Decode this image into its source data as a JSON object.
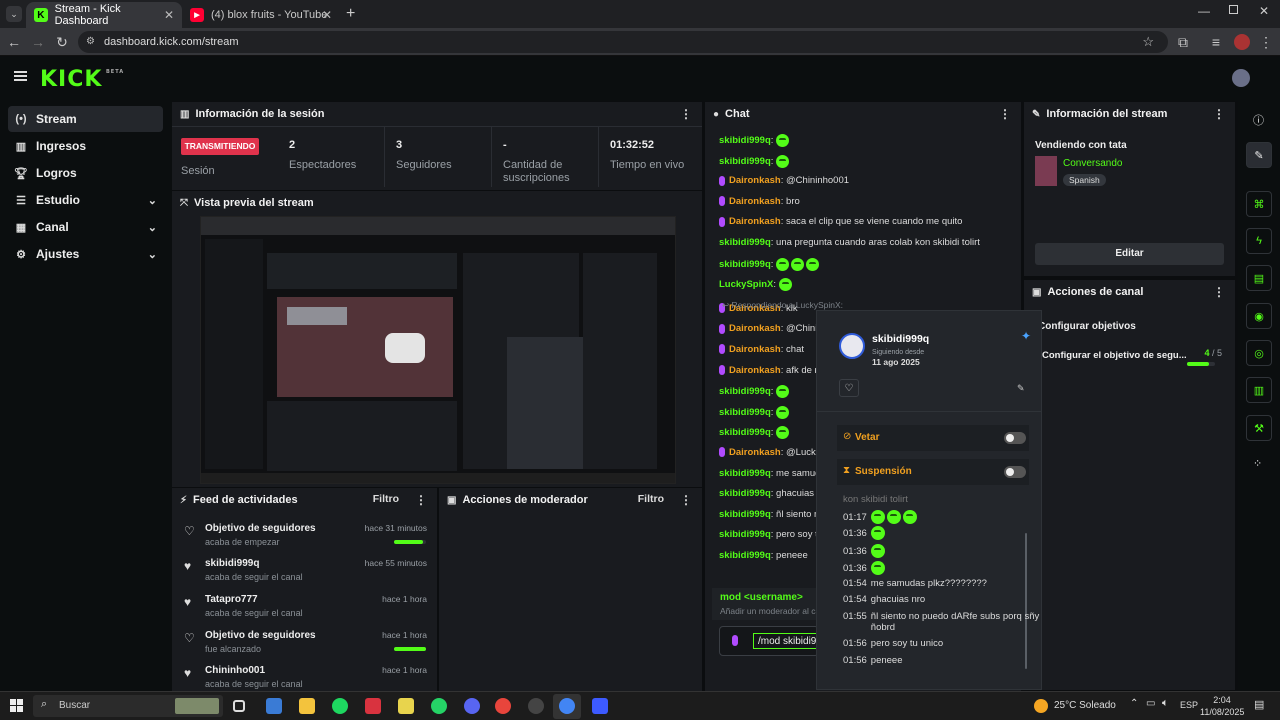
{
  "browser": {
    "tabs": [
      {
        "title": "Stream - Kick Dashboard",
        "icon": "kick-icon"
      },
      {
        "title": "(4) blox fruits - YouTube",
        "icon": "youtube-icon"
      }
    ],
    "url": "dashboard.kick.com/stream"
  },
  "brand": {
    "logo": "KICK",
    "beta": "BETA",
    "accent": "#53fc18"
  },
  "sidebar": {
    "items": [
      {
        "label": "Stream",
        "icon": "broadcast-icon"
      },
      {
        "label": "Ingresos",
        "icon": "chart-icon"
      },
      {
        "label": "Logros",
        "icon": "trophy-icon"
      },
      {
        "label": "Estudio",
        "icon": "sliders-icon"
      },
      {
        "label": "Canal",
        "icon": "grid-icon"
      },
      {
        "label": "Ajustes",
        "icon": "gear-icon"
      }
    ]
  },
  "session": {
    "title": "Información de la sesión",
    "live_badge": "TRANSMITIENDO",
    "session_label": "Sesión",
    "stats": [
      {
        "value": "2",
        "label": "Espectadores"
      },
      {
        "value": "3",
        "label": "Seguidores"
      },
      {
        "value": "-",
        "label": "Cantidad de suscripciones"
      },
      {
        "value": "01:32:52",
        "label": "Tiempo en vivo"
      }
    ]
  },
  "preview": {
    "title": "Vista previa del stream"
  },
  "feed": {
    "title": "Feed de actividades",
    "filter": "Filtro",
    "items": [
      {
        "title": "Objetivo de seguidores",
        "sub": "acaba de empezar",
        "when": "hace 31 minutos",
        "progress": 0.9
      },
      {
        "title": "skibidi999q",
        "sub": "acaba de seguir el canal",
        "when": "hace 55 minutos"
      },
      {
        "title": "Tatapro777",
        "sub": "acaba de seguir el canal",
        "when": "hace 1 hora"
      },
      {
        "title": "Objetivo de seguidores",
        "sub": "fue alcanzado",
        "when": "hace 1 hora",
        "progress": 1.0
      },
      {
        "title": "Chininho001",
        "sub": "acaba de seguir el canal",
        "when": "hace 1 hora"
      }
    ]
  },
  "mod_actions": {
    "title": "Acciones de moderador",
    "filter": "Filtro"
  },
  "chat": {
    "title": "Chat",
    "messages": [
      {
        "user": "skibidi999q",
        "text": "",
        "emotes": 1,
        "mic": false
      },
      {
        "user": "skibidi999q",
        "text": "",
        "emotes": 1,
        "mic": false
      },
      {
        "user": "Daironkash",
        "text": "@Chininho001",
        "emotes": 0,
        "mic": true
      },
      {
        "user": "Daironkash",
        "text": "bro",
        "emotes": 0,
        "mic": true
      },
      {
        "user": "Daironkash",
        "text": "saca el clip que se viene cuando me quito",
        "emotes": 0,
        "mic": true
      },
      {
        "user": "skibidi999q",
        "text": "una pregunta cuando aras colab kon skibidi tolirt",
        "emotes": 0,
        "mic": false
      },
      {
        "user": "skibidi999q",
        "text": "",
        "emotes": 3,
        "mic": false
      },
      {
        "user": "LuckySpinX",
        "text": "",
        "emotes": 1,
        "mic": false
      },
      {
        "user": "Daironkash",
        "text": "klk",
        "emotes": 0,
        "mic": true
      },
      {
        "user": "Daironkash",
        "text": "@Chini",
        "emotes": 0,
        "mic": true
      },
      {
        "user": "Daironkash",
        "text": "chat",
        "emotes": 0,
        "mic": true
      },
      {
        "user": "Daironkash",
        "text": "afk de r",
        "emotes": 0,
        "mic": true
      },
      {
        "user": "skibidi999q",
        "text": "",
        "emotes": 1,
        "mic": false
      },
      {
        "user": "skibidi999q",
        "text": "",
        "emotes": 1,
        "mic": false
      },
      {
        "user": "skibidi999q",
        "text": "",
        "emotes": 1,
        "mic": false
      },
      {
        "user": "Daironkash",
        "text": "@Lucky",
        "emotes": 0,
        "mic": true
      },
      {
        "user": "skibidi999q",
        "text": "me samud",
        "emotes": 0,
        "mic": false
      },
      {
        "user": "skibidi999q",
        "text": "ghacuias r",
        "emotes": 0,
        "mic": false
      },
      {
        "user": "skibidi999q",
        "text": "ñl siento n",
        "emotes": 0,
        "mic": false
      },
      {
        "user": "skibidi999q",
        "text": "pero soy t",
        "emotes": 0,
        "mic": false
      },
      {
        "user": "skibidi999q",
        "text": "peneee",
        "emotes": 0,
        "mic": false
      }
    ],
    "reply_hint": "Respondiendo a LuckySpinX:",
    "command_hint": "mod <username>",
    "command_desc": "Añadir un moderador al canal",
    "input_value": "/mod skibidi9"
  },
  "stream_info": {
    "title": "Información del stream",
    "stream_title": "Vendiendo con tata",
    "category": "Conversando",
    "language": "Spanish",
    "edit": "Editar"
  },
  "channel_actions": {
    "title": "Acciones de canal",
    "configure": "Configurar objetivos",
    "goal": "Configurar el objetivo de segu...",
    "goal_count": "4",
    "goal_total": "/ 5",
    "goal_progress": 0.8
  },
  "user_popup": {
    "username": "skibidi999q",
    "following_label": "Siguiendo desde",
    "following_date": "11 ago 2025",
    "ban_label": "Vetar",
    "timeout_label": "Suspensión",
    "history": [
      {
        "time": "",
        "text": "kon skibidi tolirt"
      },
      {
        "time": "01:17",
        "text": "",
        "emotes": 3
      },
      {
        "time": "01:36",
        "text": "",
        "emotes": 1
      },
      {
        "time": "01:36",
        "text": "",
        "emotes": 1
      },
      {
        "time": "01:36",
        "text": "",
        "emotes": 1
      },
      {
        "time": "01:54",
        "text": "me samudas plkz????????"
      },
      {
        "time": "01:54",
        "text": "ghacuias nro"
      },
      {
        "time": "01:55",
        "text": "ñl siento no puedo dARfe subs porq sñy ñobrd"
      },
      {
        "time": "01:56",
        "text": "pero soy tu unico"
      },
      {
        "time": "01:56",
        "text": "peneee"
      }
    ]
  },
  "taskbar": {
    "search": "Buscar",
    "weather": "25°C Soleado",
    "lang": "ESP",
    "time": "2:04",
    "date": "11/08/2025"
  }
}
